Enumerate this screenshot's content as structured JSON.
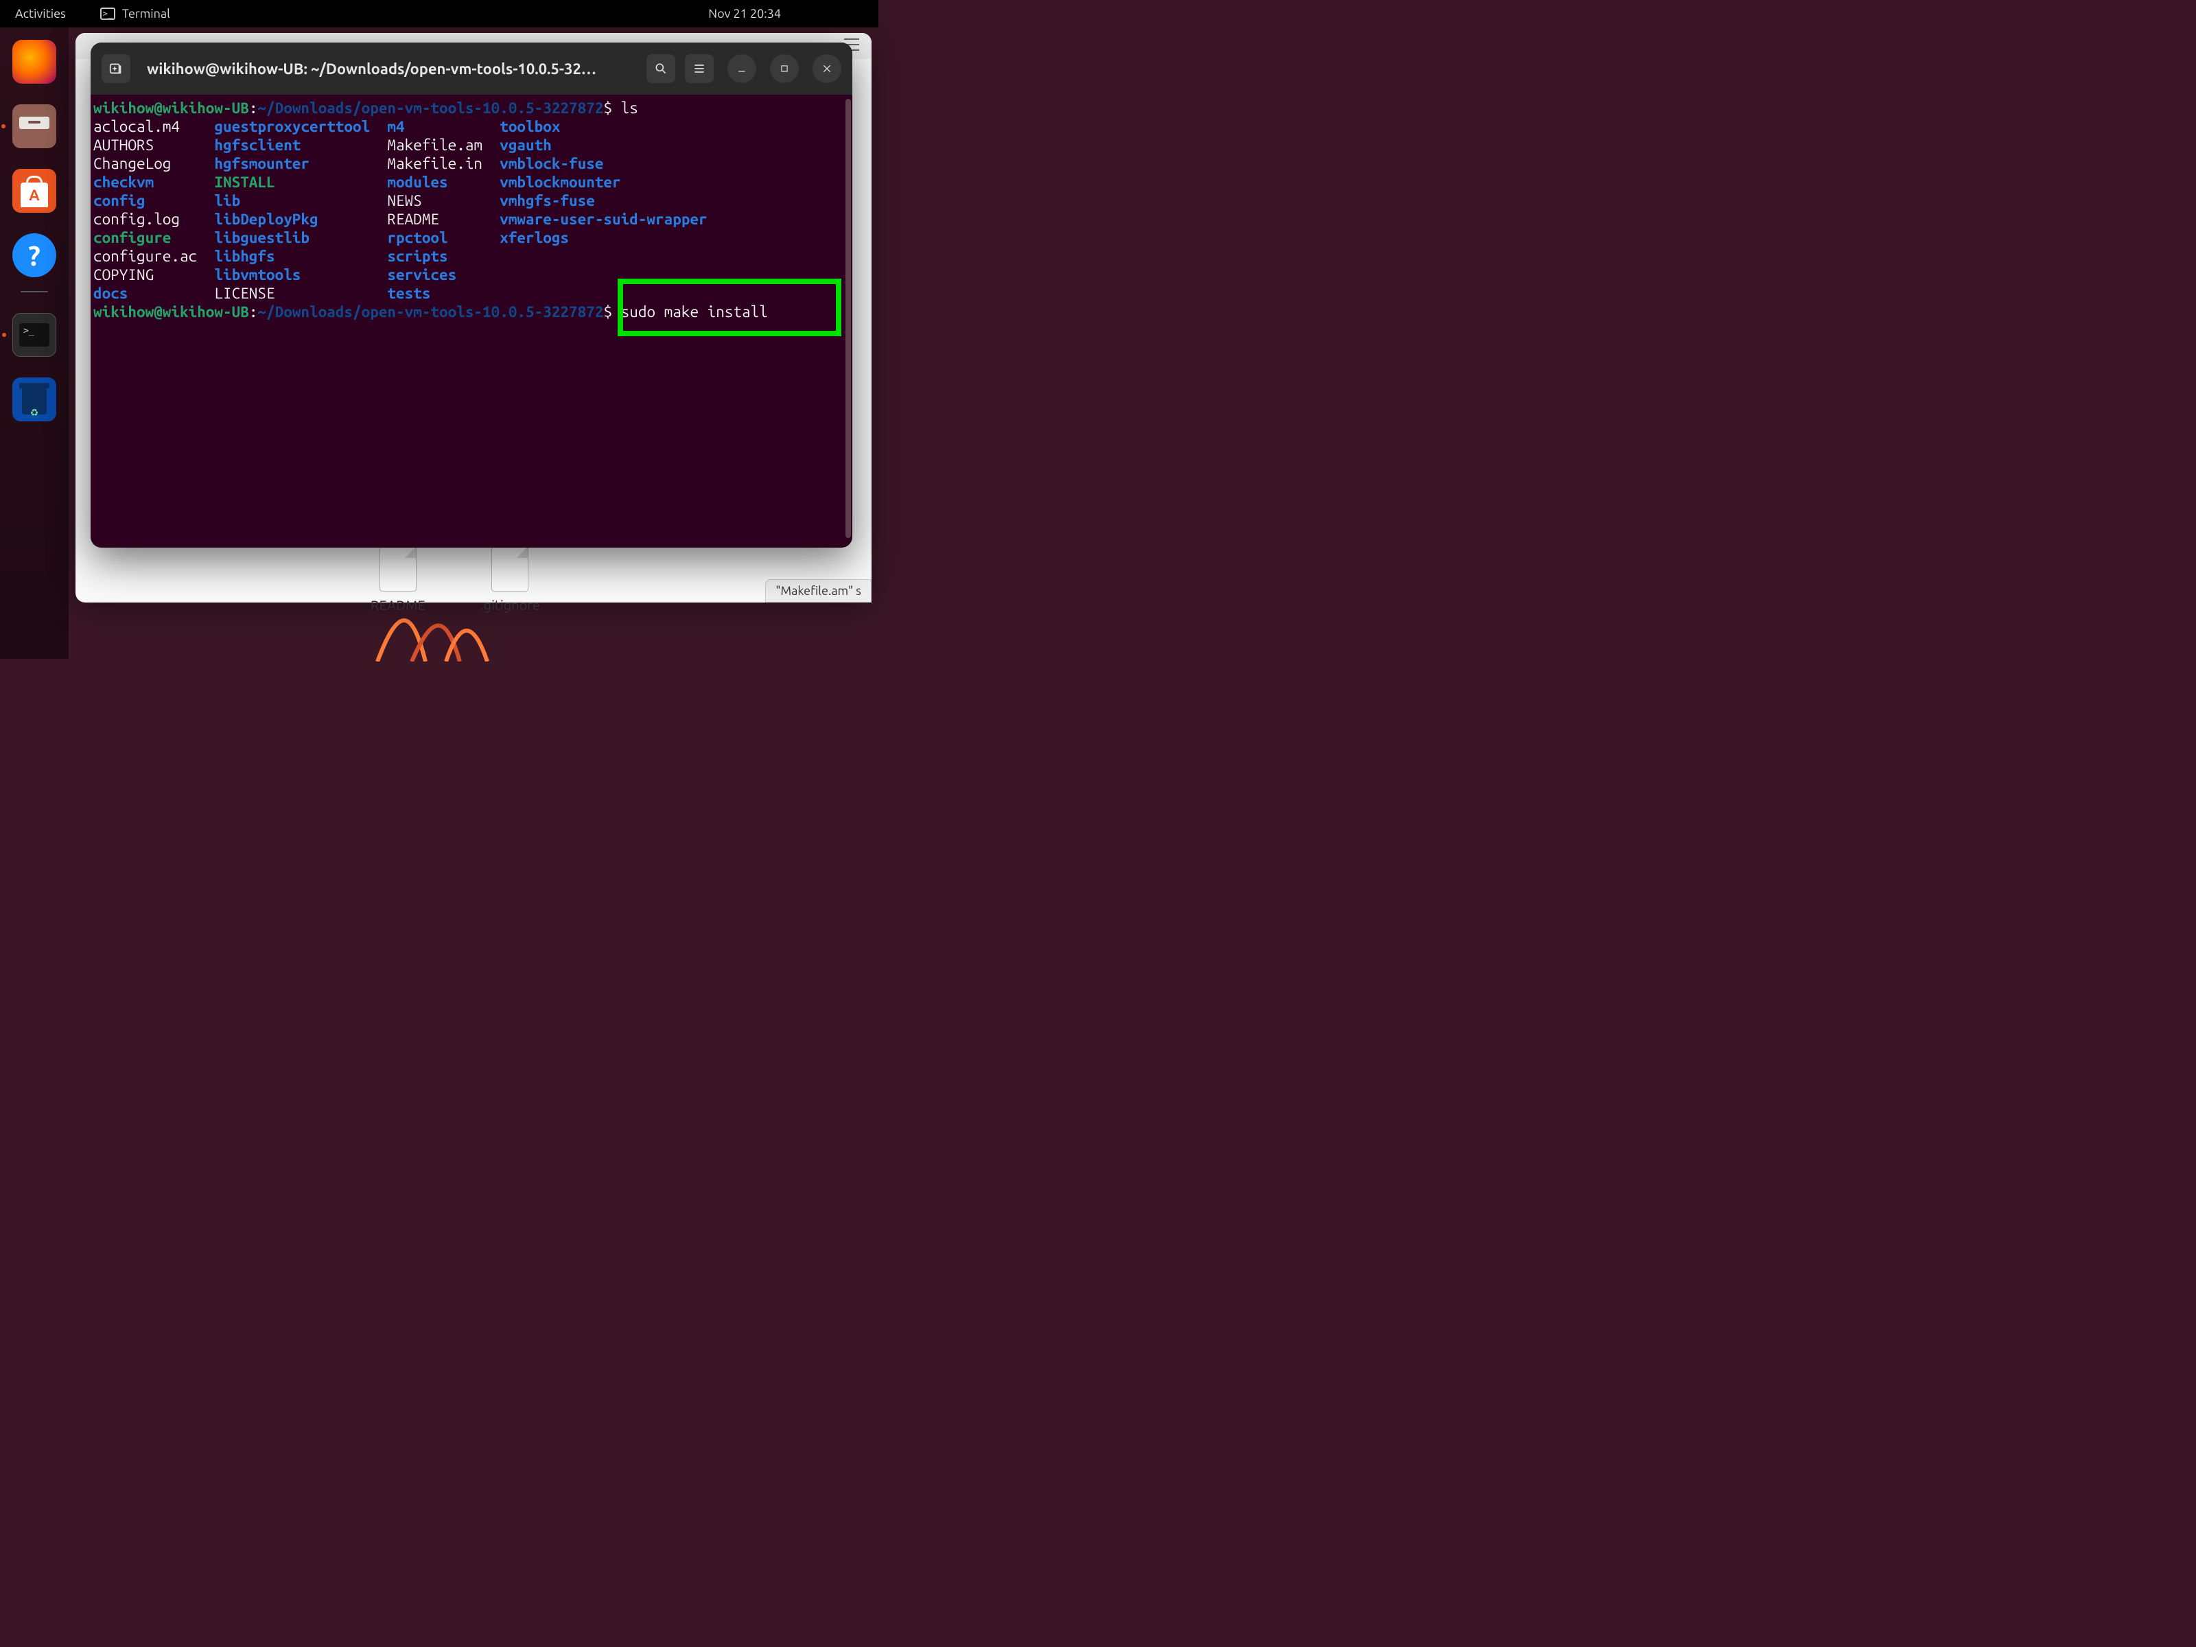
{
  "topbar": {
    "activities": "Activities",
    "app_label": "Terminal",
    "clock": "Nov 21  20:34"
  },
  "dock": {
    "tooltip_trash": "Trash"
  },
  "files_window": {
    "file1": "README",
    "file2": ".gitignore",
    "status": "\"Makefile.am\" s"
  },
  "terminal": {
    "title": "wikihow@wikihow-UB: ~/Downloads/open-vm-tools-10.0.5-32…",
    "prompt_user": "wikihow@wikihow-UB",
    "prompt_sep1": ":",
    "prompt_path": "~/Downloads/open-vm-tools-10.0.5-3227872",
    "prompt_sep2": "$ ",
    "cmd1": "ls",
    "cmd2": "sudo make install",
    "ls": {
      "c1": [
        "aclocal.m4",
        "AUTHORS",
        "ChangeLog",
        "checkvm",
        "config",
        "config.log",
        "configure",
        "configure.ac",
        "COPYING",
        "docs"
      ],
      "c1_cls": [
        "w",
        "w",
        "w",
        "d",
        "d",
        "w",
        "g",
        "w",
        "w",
        "d"
      ],
      "c2": [
        "guestproxycerttool",
        "hgfsclient",
        "hgfsmounter",
        "INSTALL",
        "lib",
        "libDeployPkg",
        "libguestlib",
        "libhgfs",
        "libvmtools",
        "LICENSE"
      ],
      "c2_cls": [
        "d",
        "d",
        "d",
        "g",
        "d",
        "d",
        "d",
        "d",
        "d",
        "w"
      ],
      "c3": [
        "m4",
        "Makefile.am",
        "Makefile.in",
        "modules",
        "NEWS",
        "README",
        "rpctool",
        "scripts",
        "services",
        "tests"
      ],
      "c3_cls": [
        "d",
        "w",
        "w",
        "d",
        "w",
        "w",
        "d",
        "d",
        "d",
        "d"
      ],
      "c4": [
        "toolbox",
        "vgauth",
        "vmblock-fuse",
        "vmblockmounter",
        "vmhgfs-fuse",
        "vmware-user-suid-wrapper",
        "xferlogs",
        "",
        "",
        ""
      ],
      "c4_cls": [
        "d",
        "d",
        "d",
        "d",
        "d",
        "d",
        "d",
        "w",
        "w",
        "w"
      ]
    }
  }
}
